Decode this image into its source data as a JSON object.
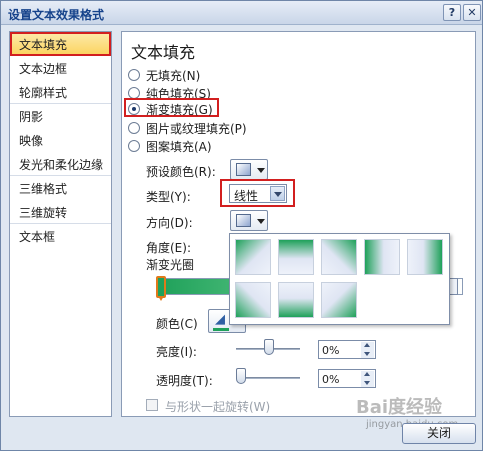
{
  "window": {
    "title": "设置文本效果格式",
    "help_label": "?",
    "close_label": "✕"
  },
  "nav": {
    "items": [
      {
        "label": "文本填充"
      },
      {
        "label": "文本边框"
      },
      {
        "label": "轮廓样式"
      },
      {
        "label": "阴影"
      },
      {
        "label": "映像"
      },
      {
        "label": "发光和柔化边缘"
      },
      {
        "label": "三维格式"
      },
      {
        "label": "三维旋转"
      },
      {
        "label": "文本框"
      }
    ],
    "selected_index": 0
  },
  "panel": {
    "heading": "文本填充",
    "fill_options": [
      {
        "label": "无填充(N)",
        "selected": false
      },
      {
        "label": "纯色填充(S)",
        "selected": false
      },
      {
        "label": "渐变填充(G)",
        "selected": true
      },
      {
        "label": "图片或纹理填充(P)",
        "selected": false
      },
      {
        "label": "图案填充(A)",
        "selected": false
      }
    ],
    "preset_colors_label": "预设颜色(R):",
    "type_label": "类型(Y):",
    "type_value": "线性",
    "direction_label": "方向(D):",
    "angle_label": "角度(E):",
    "gradient_stops_label": "渐变光圈",
    "color_label": "颜色(C)",
    "brightness_label": "亮度(I):",
    "brightness_value": "0%",
    "transparency_label": "透明度(T):",
    "transparency_value": "0%",
    "rotate_with_shape_label": "与形状一起旋转(W)",
    "rotate_with_shape_checked": false
  },
  "direction_popup": {
    "cells": [
      {
        "name": "linear-diagonal-top-left"
      },
      {
        "name": "linear-down"
      },
      {
        "name": "linear-diagonal-top-right"
      },
      {
        "name": "linear-right"
      },
      {
        "name": "linear-left"
      },
      {
        "name": "linear-diagonal-bottom-left"
      },
      {
        "name": "linear-up"
      },
      {
        "name": "linear-diagonal-bottom-right"
      }
    ]
  },
  "colors": {
    "accent_green": "#1fa15a",
    "highlight_red": "#d21f1f",
    "selection_yellow": "#fbd462",
    "title_blue": "#15428b"
  },
  "footer": {
    "close_label": "关闭"
  },
  "watermark": {
    "text": "Bai度经验",
    "sub": "jingyan.baidu.com"
  }
}
